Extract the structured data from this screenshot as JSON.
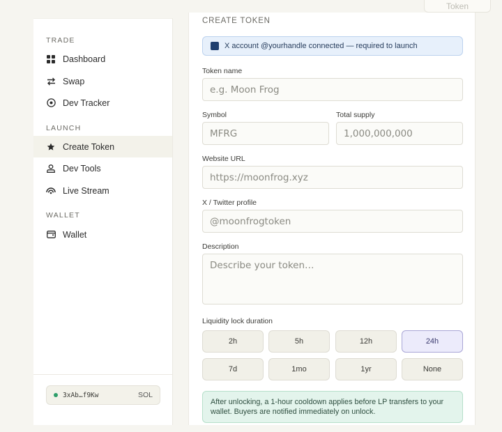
{
  "top_tab": {
    "label": "Token"
  },
  "sidebar": {
    "sections": [
      {
        "label": "TRADE",
        "items": [
          {
            "label": "Dashboard",
            "icon": "grid-icon"
          },
          {
            "label": "Swap",
            "icon": "swap-arrows-icon"
          },
          {
            "label": "Dev Tracker",
            "icon": "target-icon"
          }
        ]
      },
      {
        "label": "LAUNCH",
        "items": [
          {
            "label": "Create Token",
            "icon": "star-icon",
            "active": true
          },
          {
            "label": "Dev Tools",
            "icon": "user-icon"
          },
          {
            "label": "Live Stream",
            "icon": "broadcast-icon"
          }
        ]
      },
      {
        "label": "WALLET",
        "items": [
          {
            "label": "Wallet",
            "icon": "wallet-icon"
          }
        ]
      }
    ],
    "wallet_chip": {
      "address": "3xAb…f9Kw",
      "currency": "SOL",
      "status_color": "#2e9e6a"
    }
  },
  "form": {
    "title": "CREATE TOKEN",
    "banner": "X account @yourhandle connected — required to launch",
    "token_name": {
      "label": "Token name",
      "placeholder": "e.g. Moon Frog",
      "value": ""
    },
    "symbol": {
      "label": "Symbol",
      "placeholder": "MFRG",
      "value": ""
    },
    "total_supply": {
      "label": "Total supply",
      "placeholder": "1,000,000,000",
      "value": ""
    },
    "website": {
      "label": "Website URL",
      "placeholder": "https://moonfrog.xyz",
      "value": ""
    },
    "twitter": {
      "label": "X / Twitter profile",
      "placeholder": "@moonfrogtoken",
      "value": ""
    },
    "description": {
      "label": "Description",
      "placeholder": "Describe your token…",
      "value": ""
    },
    "lock": {
      "label": "Liquidity lock duration",
      "options": [
        "2h",
        "5h",
        "12h",
        "24h",
        "7d",
        "1mo",
        "1yr",
        "None"
      ],
      "selected": "24h"
    },
    "note": "After unlocking, a 1-hour cooldown applies before LP transfers to your wallet. Buyers are notified immediately on unlock."
  },
  "colors": {
    "accent_selected": "#ecebfb",
    "banner_bg": "#e7f0fb",
    "note_bg": "#e3f4ec",
    "active_nav": "#f3f2ea"
  }
}
